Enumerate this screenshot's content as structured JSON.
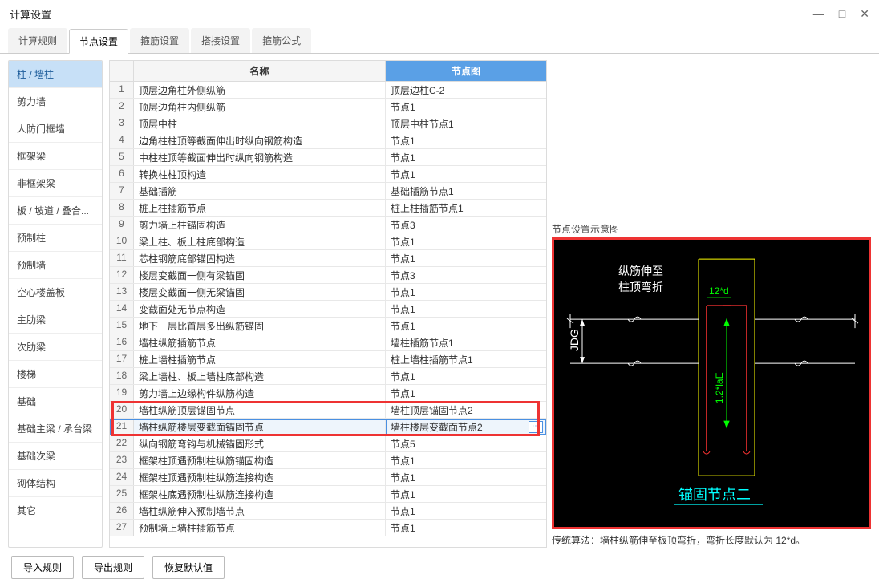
{
  "window": {
    "title": "计算设置"
  },
  "tabs": [
    "计算规则",
    "节点设置",
    "箍筋设置",
    "搭接设置",
    "箍筋公式"
  ],
  "activeTab": 1,
  "sidebar": {
    "items": [
      "柱 / 墙柱",
      "剪力墙",
      "人防门框墙",
      "框架梁",
      "非框架梁",
      "板 / 坡道 / 叠合...",
      "预制柱",
      "预制墙",
      "空心楼盖板",
      "主肋梁",
      "次肋梁",
      "楼梯",
      "基础",
      "基础主梁 / 承台梁",
      "基础次梁",
      "砌体结构",
      "其它"
    ],
    "activeIndex": 0
  },
  "table": {
    "headers": {
      "num": "",
      "name": "名称",
      "node": "节点图"
    },
    "rows": [
      {
        "n": "1",
        "name": "顶层边角柱外侧纵筋",
        "node": "顶层边柱C-2"
      },
      {
        "n": "2",
        "name": "顶层边角柱内侧纵筋",
        "node": "节点1"
      },
      {
        "n": "3",
        "name": "顶层中柱",
        "node": "顶层中柱节点1"
      },
      {
        "n": "4",
        "name": "边角柱柱顶等截面伸出时纵向钢筋构造",
        "node": "节点1"
      },
      {
        "n": "5",
        "name": "中柱柱顶等截面伸出时纵向钢筋构造",
        "node": "节点1"
      },
      {
        "n": "6",
        "name": "转换柱柱顶构造",
        "node": "节点1"
      },
      {
        "n": "7",
        "name": "基础插筋",
        "node": "基础插筋节点1"
      },
      {
        "n": "8",
        "name": "桩上柱插筋节点",
        "node": "桩上柱插筋节点1"
      },
      {
        "n": "9",
        "name": "剪力墙上柱锚固构造",
        "node": "节点3"
      },
      {
        "n": "10",
        "name": "梁上柱、板上柱底部构造",
        "node": "节点1"
      },
      {
        "n": "11",
        "name": "芯柱钢筋底部锚固构造",
        "node": "节点1"
      },
      {
        "n": "12",
        "name": "楼层变截面一侧有梁锚固",
        "node": "节点3"
      },
      {
        "n": "13",
        "name": "楼层变截面一侧无梁锚固",
        "node": "节点1"
      },
      {
        "n": "14",
        "name": "变截面处无节点构造",
        "node": "节点1"
      },
      {
        "n": "15",
        "name": "地下一层比首层多出纵筋锚固",
        "node": "节点1"
      },
      {
        "n": "16",
        "name": "墙柱纵筋插筋节点",
        "node": "墙柱插筋节点1"
      },
      {
        "n": "17",
        "name": "桩上墙柱插筋节点",
        "node": "桩上墙柱插筋节点1"
      },
      {
        "n": "18",
        "name": "梁上墙柱、板上墙柱底部构造",
        "node": "节点1"
      },
      {
        "n": "19",
        "name": "剪力墙上边缘构件纵筋构造",
        "node": "节点1"
      },
      {
        "n": "20",
        "name": "墙柱纵筋顶层锚固节点",
        "node": "墙柱顶层锚固节点2"
      },
      {
        "n": "21",
        "name": "墙柱纵筋楼层变截面锚固节点",
        "node": "墙柱楼层变截面节点2",
        "selected": true
      },
      {
        "n": "22",
        "name": "纵向钢筋弯钩与机械锚固形式",
        "node": "节点5"
      },
      {
        "n": "23",
        "name": "框架柱顶遇预制柱纵筋锚固构造",
        "node": "节点1"
      },
      {
        "n": "24",
        "name": "框架柱顶遇预制柱纵筋连接构造",
        "node": "节点1"
      },
      {
        "n": "25",
        "name": "框架柱底遇预制柱纵筋连接构造",
        "node": "节点1"
      },
      {
        "n": "26",
        "name": "墙柱纵筋伸入预制墙节点",
        "node": "节点1"
      },
      {
        "n": "27",
        "name": "预制墙上墙柱插筋节点",
        "node": "节点1"
      }
    ]
  },
  "preview": {
    "title": "节点设置示意图",
    "caption": "传统算法：墙柱纵筋伸至板顶弯折，弯折长度默认为 12*d。",
    "diagram": {
      "text1": "纵筋伸至",
      "text2": "柱顶弯折",
      "annot12d": "12*d",
      "annotJDG": "JDG",
      "annot12laE": "1.2*laE",
      "bottomLabel": "锚固节点二"
    }
  },
  "footer": {
    "importBtn": "导入规则",
    "exportBtn": "导出规则",
    "resetBtn": "恢复默认值"
  }
}
